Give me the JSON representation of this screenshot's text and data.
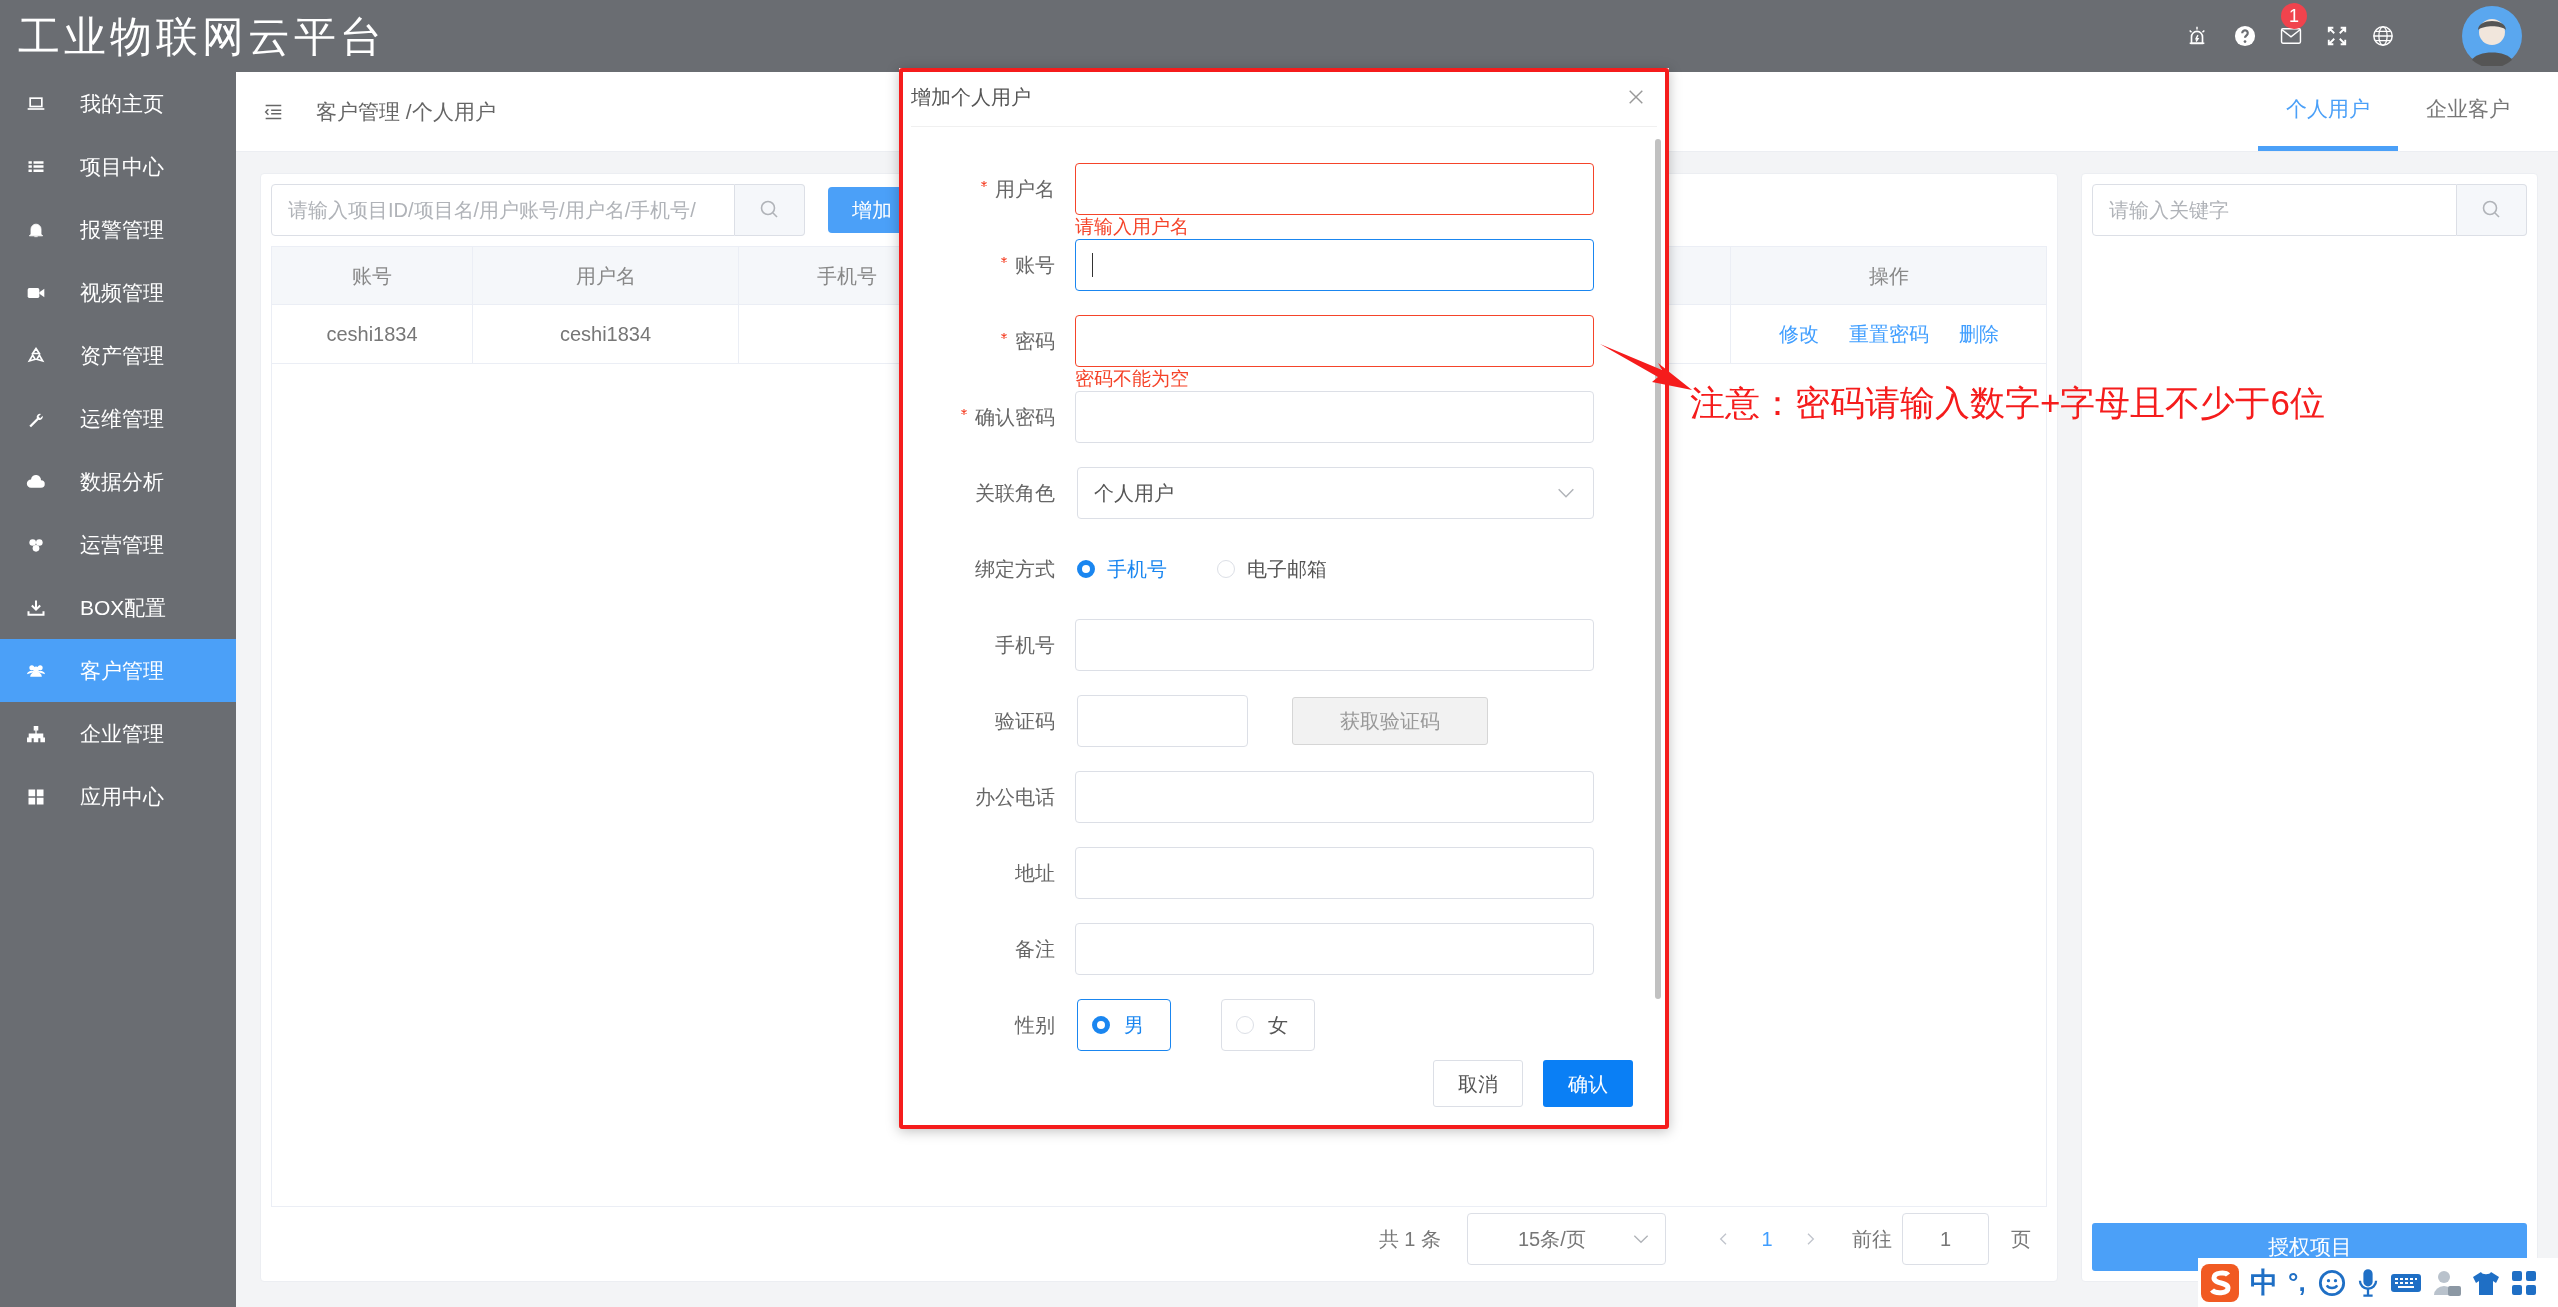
{
  "header": {
    "title": "工业物联网云平台",
    "notification_count": "1"
  },
  "sidebar": {
    "items": [
      {
        "label": "我的主页",
        "selected": false
      },
      {
        "label": "项目中心",
        "selected": false
      },
      {
        "label": "报警管理",
        "selected": false
      },
      {
        "label": "视频管理",
        "selected": false
      },
      {
        "label": "资产管理",
        "selected": false
      },
      {
        "label": "运维管理",
        "selected": false
      },
      {
        "label": "数据分析",
        "selected": false
      },
      {
        "label": "运营管理",
        "selected": false
      },
      {
        "label": "BOX配置",
        "selected": false
      },
      {
        "label": "客户管理",
        "selected": true
      },
      {
        "label": "企业管理",
        "selected": false
      },
      {
        "label": "应用中心",
        "selected": false
      }
    ]
  },
  "breadcrumb": "客户管理 /个人用户",
  "tabs": [
    {
      "label": "个人用户",
      "selected": true
    },
    {
      "label": "企业客户",
      "selected": false
    }
  ],
  "search": {
    "placeholder": "请输入项目ID/项目名/用户账号/用户名/手机号/"
  },
  "add_button": "增加",
  "table": {
    "columns": [
      "账号",
      "用户名",
      "手机号",
      "操作"
    ],
    "rows": [
      {
        "cells": [
          "ceshi1834",
          "ceshi1834"
        ],
        "actions": [
          "修改",
          "重置密码",
          "删除"
        ]
      }
    ]
  },
  "pagination": {
    "total": "共 1 条",
    "page_size": "15条/页",
    "pages": [
      {
        "label": "1",
        "selected": true
      }
    ],
    "goto_label": "前往",
    "goto_value": "1",
    "goto_suffix": "页"
  },
  "side_panel": {
    "search_placeholder": "请输入关键字",
    "button": "授权项目"
  },
  "dialog": {
    "title": "增加个人用户",
    "fields": [
      {
        "kind": "input",
        "label": "用户名",
        "required": true,
        "invalid": true,
        "focused": false,
        "error": "请输入用户名"
      },
      {
        "kind": "input",
        "label": "账号",
        "required": true,
        "invalid": false,
        "focused": true
      },
      {
        "kind": "input",
        "label": "密码",
        "required": true,
        "invalid": true,
        "focused": false,
        "error": "密码不能为空"
      },
      {
        "kind": "input",
        "label": "确认密码",
        "required": true,
        "invalid": false,
        "focused": false
      },
      {
        "kind": "select",
        "label": "关联角色",
        "value": "个人用户"
      },
      {
        "kind": "radio",
        "label": "绑定方式",
        "options": [
          {
            "label": "手机号",
            "selected": true
          },
          {
            "label": "电子邮箱",
            "selected": false
          }
        ]
      },
      {
        "kind": "input",
        "label": "手机号",
        "invalid": false,
        "focused": false
      },
      {
        "kind": "code",
        "label": "验证码",
        "button": "获取验证码"
      },
      {
        "kind": "input",
        "label": "办公电话",
        "invalid": false,
        "focused": false
      },
      {
        "kind": "input",
        "label": "地址",
        "invalid": false,
        "focused": false
      },
      {
        "kind": "input",
        "label": "备注",
        "invalid": false,
        "focused": false
      },
      {
        "kind": "radio_box",
        "label": "性别",
        "options": [
          {
            "label": "男",
            "selected": true
          },
          {
            "label": "女",
            "selected": false
          }
        ]
      }
    ],
    "buttons": [
      {
        "label": "取消",
        "kind": "default"
      },
      {
        "label": "确认",
        "kind": "primary"
      }
    ]
  },
  "annotation": {
    "text": "注意：密码请输入数字+字母且不少于6位"
  },
  "ime_toolbar": {
    "lang": "中",
    "punct": "°,"
  }
}
